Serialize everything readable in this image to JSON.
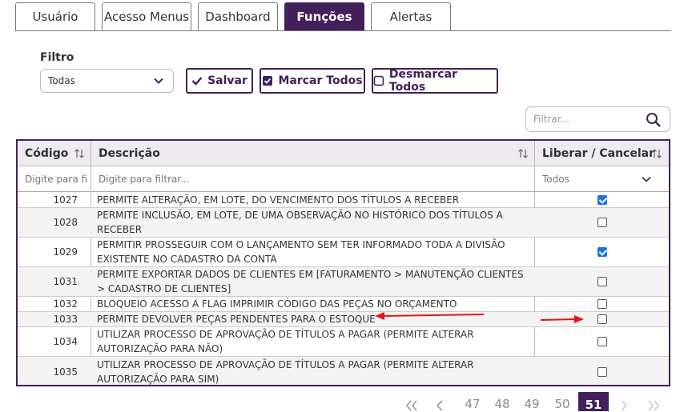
{
  "tabs": [
    {
      "label": "Usuário",
      "active": false
    },
    {
      "label": "Acesso Menus",
      "active": false
    },
    {
      "label": "Dashboard",
      "active": false
    },
    {
      "label": "Funções",
      "active": true
    },
    {
      "label": "Alertas",
      "active": false
    }
  ],
  "filter": {
    "label": "Filtro",
    "selected": "Todas"
  },
  "actions": {
    "save": "Salvar",
    "check_all": "Marcar Todos",
    "uncheck_all": "Desmarcar Todos"
  },
  "search": {
    "placeholder": "Filtrar..."
  },
  "table": {
    "headers": {
      "code": "Código",
      "description": "Descrição",
      "toggle": "Liberar / Cancelar"
    },
    "filters": {
      "code_placeholder": "Digite para fi",
      "description_placeholder": "Digite para filtrar...",
      "toggle_selected": "Todos"
    },
    "rows": [
      {
        "code": "1027",
        "description": "PERMITE ALTERAÇÃO, EM LOTE, DO VENCIMENTO DOS TÍTULOS A RECEBER",
        "checked": true
      },
      {
        "code": "1028",
        "description": "PERMITE INCLUSÃO, EM LOTE, DE UMA OBSERVAÇÃO NO HISTÓRICO DOS TÍTULOS A RECEBER",
        "checked": false
      },
      {
        "code": "1029",
        "description": "PERMITIR PROSSEGUIR COM O LANÇAMENTO SEM TER INFORMADO TODA A DIVISÃO EXISTENTE NO CADASTRO DA CONTA",
        "checked": true
      },
      {
        "code": "1031",
        "description": "PERMITE EXPORTAR DADOS DE CLIENTES EM [FATURAMENTO > MANUTENÇÃO CLIENTES > CADASTRO DE CLIENTES]",
        "checked": false
      },
      {
        "code": "1032",
        "description": "BLOQUEIO ACESSO A FLAG IMPRIMIR CÓDIGO DAS PEÇAS NO ORÇAMENTO",
        "checked": false
      },
      {
        "code": "1033",
        "description": "PERMITE DEVOLVER PEÇAS PENDENTES PARA O ESTOQUE",
        "checked": false
      },
      {
        "code": "1034",
        "description": "UTILIZAR PROCESSO DE APROVAÇÃO DE TÍTULOS A PAGAR (PERMITE ALTERAR AUTORIZAÇÃO PARA NÃO)",
        "checked": false
      },
      {
        "code": "1035",
        "description": "UTILIZAR PROCESSO DE APROVAÇÃO DE TÍTULOS A PAGAR (PERMITE ALTERAR AUTORIZAÇÃO PARA SIM)",
        "checked": false
      }
    ]
  },
  "pagination": {
    "pages": [
      "47",
      "48",
      "49",
      "50",
      "51"
    ],
    "current": "51",
    "first_icon": "double-chevron-left-icon",
    "prev_icon": "chevron-left-icon",
    "next_icon": "chevron-right-icon",
    "last_icon": "double-chevron-right-icon"
  },
  "colors": {
    "brand": "#43205a",
    "checkbox_checked": "#1a73e8",
    "annotation_arrow": "#e5141b"
  }
}
